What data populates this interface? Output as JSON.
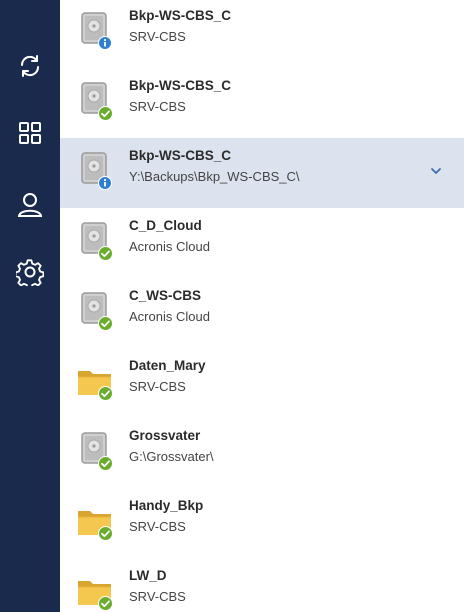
{
  "sidebar": {
    "items": [
      {
        "name": "backup",
        "icon": "sync-icon"
      },
      {
        "name": "dashboard",
        "icon": "dashboard-grid-icon"
      },
      {
        "name": "account",
        "icon": "user-icon"
      },
      {
        "name": "settings",
        "icon": "gear-icon"
      }
    ],
    "background": "#1a2a4d",
    "icon_color": "#ffffff"
  },
  "backups": [
    {
      "name": "Bkp-WS-CBS_C",
      "location": "SRV-CBS",
      "source_icon": "disk-icon",
      "status": "info",
      "selected": false
    },
    {
      "name": "Bkp-WS-CBS_C",
      "location": "SRV-CBS",
      "source_icon": "disk-icon",
      "status": "ok",
      "selected": false
    },
    {
      "name": "Bkp-WS-CBS_C",
      "location": "Y:\\Backups\\Bkp_WS-CBS_C\\",
      "source_icon": "disk-icon",
      "status": "info",
      "selected": true
    },
    {
      "name": "C_D_Cloud",
      "location": "Acronis Cloud",
      "source_icon": "disk-icon",
      "status": "ok",
      "selected": false
    },
    {
      "name": "C_WS-CBS",
      "location": "Acronis Cloud",
      "source_icon": "disk-icon",
      "status": "ok",
      "selected": false
    },
    {
      "name": "Daten_Mary",
      "location": "SRV-CBS",
      "source_icon": "folder-icon",
      "status": "ok",
      "selected": false
    },
    {
      "name": "Grossvater",
      "location": "G:\\Grossvater\\",
      "source_icon": "disk-icon",
      "status": "ok",
      "selected": false
    },
    {
      "name": "Handy_Bkp",
      "location": "SRV-CBS",
      "source_icon": "folder-icon",
      "status": "ok",
      "selected": false
    },
    {
      "name": "LW_D",
      "location": "SRV-CBS",
      "source_icon": "folder-icon",
      "status": "ok",
      "selected": false
    }
  ],
  "colors": {
    "selected_row": "#dce3ee",
    "status_ok": "#6aad2c",
    "status_info": "#2f7fd1",
    "chevron": "#3a6fb0"
  }
}
